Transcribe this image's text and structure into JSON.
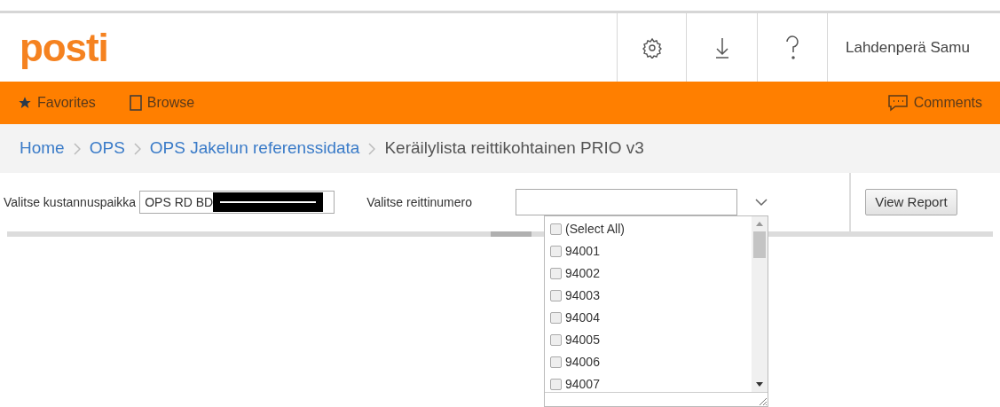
{
  "header": {
    "logo": "posti",
    "user": "Lahdenperä Samu"
  },
  "nav": {
    "items": [
      {
        "label": "Favorites",
        "kind": "star"
      },
      {
        "label": "Browse",
        "kind": "page"
      }
    ],
    "comments": "Comments"
  },
  "breadcrumb": [
    "Home",
    "OPS",
    "OPS Jakelun referenssidata",
    "Keräilylista reittikohtainen PRIO v3"
  ],
  "params": {
    "cost_center": {
      "label": "Valitse kustannuspaikka",
      "value": "OPS RD BD",
      "redacted": true
    },
    "route": {
      "label": "Valitse reittinumero",
      "expanded": true,
      "options": [
        {
          "label": "(Select All)",
          "checked": false
        },
        {
          "label": "94001",
          "checked": false
        },
        {
          "label": "94002",
          "checked": false
        },
        {
          "label": "94003",
          "checked": false
        },
        {
          "label": "94004",
          "checked": false
        },
        {
          "label": "94005",
          "checked": false
        },
        {
          "label": "94006",
          "checked": false
        },
        {
          "label": "94007",
          "checked": false
        }
      ]
    },
    "button": "View Report"
  }
}
